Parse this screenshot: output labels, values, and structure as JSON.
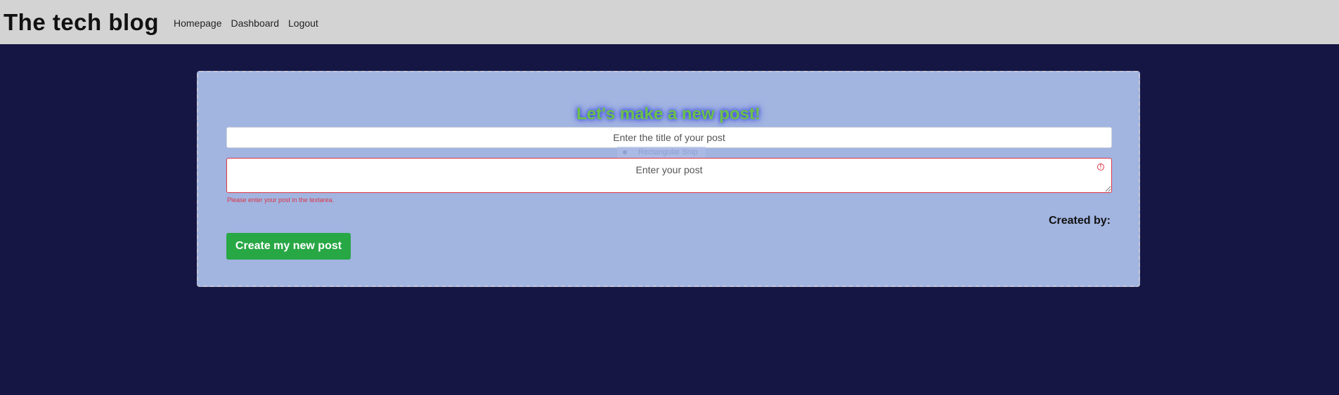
{
  "header": {
    "brand": "The tech blog",
    "nav": [
      {
        "label": "Homepage"
      },
      {
        "label": "Dashboard"
      },
      {
        "label": "Logout"
      }
    ]
  },
  "form": {
    "heading": "Let's make a new post!",
    "title_input": {
      "value": "",
      "placeholder": "Enter the title of your post"
    },
    "ghost_tooltip": "Rectangular Snip",
    "post_textarea": {
      "value": "",
      "placeholder": "Enter your post"
    },
    "validation_message": "Please enter your post in the textarea.",
    "created_by_label": "Created by:",
    "submit_label": "Create my new post"
  },
  "colors": {
    "header_bg": "#d3d3d3",
    "page_bg": "#161645",
    "card_bg": "#a2b4e0",
    "heading_color": "#6cc04a",
    "error_color": "#dc3545",
    "button_bg": "#28a745"
  }
}
